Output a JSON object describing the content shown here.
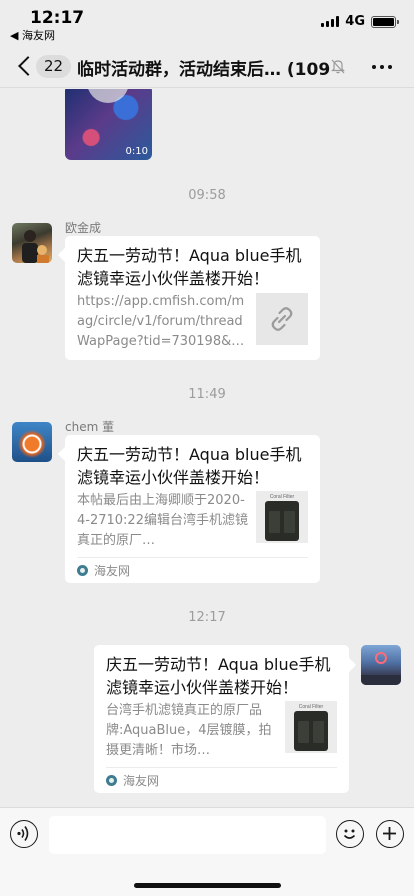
{
  "status_bar": {
    "time": "12:17",
    "back_app": "◀ 海友网",
    "network": "4G"
  },
  "nav": {
    "unread_count": "22",
    "title": "临时活动群，活动结束后… (109)"
  },
  "messages": {
    "video": {
      "duration": "0:10"
    },
    "time1": "09:58",
    "msg1": {
      "sender": "欧金成",
      "title": "庆五一劳动节！Aqua blue手机滤镜幸运小伙伴盖楼开始！",
      "desc": "https://app.cmfish.com/mag/circle/v1/forum/threadWapPage?tid=730198&…"
    },
    "time2": "11:49",
    "msg2": {
      "sender": "chem 董",
      "title": "庆五一劳动节！Aqua blue手机滤镜幸运小伙伴盖楼开始！",
      "desc": "本帖最后由上海卿顺于2020-4-2710:22编辑台湾手机滤镜真正的原厂…",
      "thumb_label": "Coral Filter",
      "source": "海友网"
    },
    "time3": "12:17",
    "msg3": {
      "title": "庆五一劳动节！Aqua blue手机滤镜幸运小伙伴盖楼开始！",
      "desc": "台湾手机滤镜真正的原厂品牌:AquaBlue，4层镀膜，拍摄更清晰！市场…",
      "thumb_label": "Coral Filter",
      "source": "海友网"
    }
  },
  "colors": {
    "background": "#ededed",
    "card": "#ffffff",
    "timestamp": "#9c9c9c"
  },
  "icons": [
    "back-chevron-icon",
    "mute-bell-icon",
    "more-icon",
    "link-icon",
    "voice-icon",
    "emoji-icon",
    "plus-icon"
  ]
}
